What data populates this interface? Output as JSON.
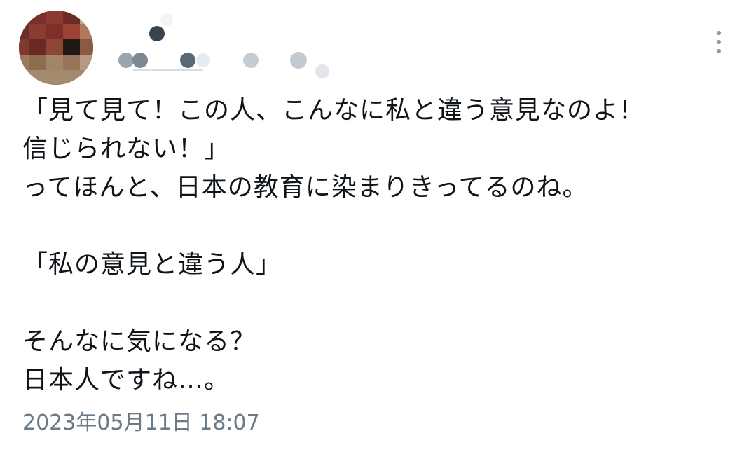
{
  "tweet": {
    "lines": [
      "「見て見て！この人、こんなに私と違う意見なのよ！",
      "信じられない！」",
      "ってほんと、日本の教育に染まりきってるのね。",
      "",
      "「私の意見と違う人」",
      "",
      "そんなに気になる？",
      "日本人ですね…。"
    ],
    "timestamp": "2023年05月11日 18:07"
  },
  "icons": {
    "more": "more-vertical-icon"
  },
  "colors": {
    "text": "#0f1419",
    "secondary": "#6b7a88",
    "icon": "#8b98a5"
  }
}
